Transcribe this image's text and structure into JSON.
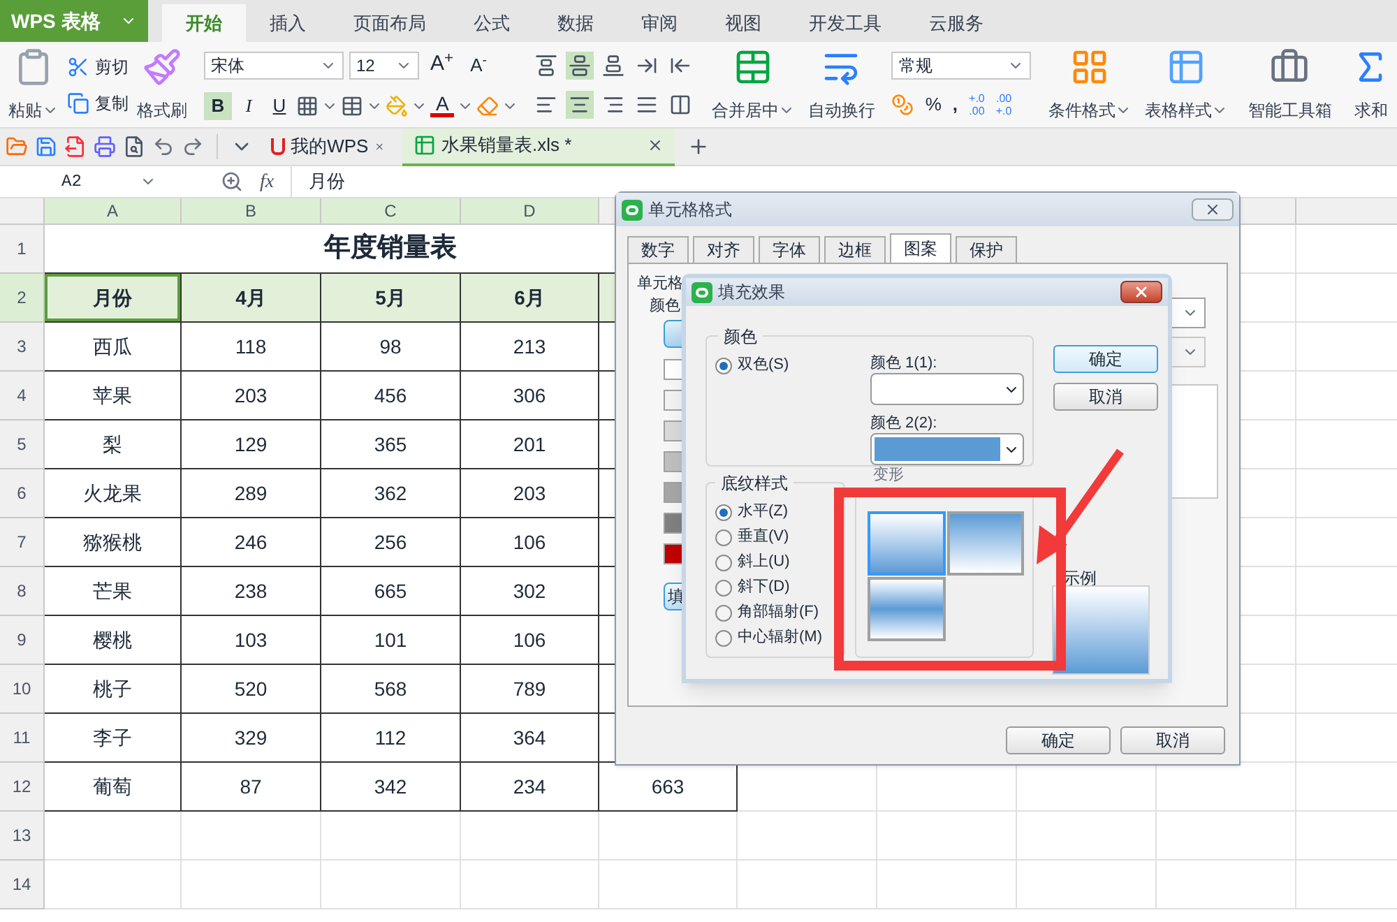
{
  "app_button": "WPS 表格",
  "menu_tabs": [
    {
      "label": "开始",
      "selected": true
    },
    {
      "label": "插入",
      "selected": false
    },
    {
      "label": "页面布局",
      "selected": false
    },
    {
      "label": "公式",
      "selected": false
    },
    {
      "label": "数据",
      "selected": false
    },
    {
      "label": "审阅",
      "selected": false
    },
    {
      "label": "视图",
      "selected": false
    },
    {
      "label": "开发工具",
      "selected": false
    },
    {
      "label": "云服务",
      "selected": false
    }
  ],
  "ribbon": {
    "paste": "粘贴",
    "cut": "剪切",
    "copy": "复制",
    "painter": "格式刷",
    "font": "宋体",
    "size": "12",
    "grow": "A$^{+}$",
    "shrink": "A$^{-}$",
    "styles": [
      {
        "label": "B",
        "kind": "bold",
        "on": true
      },
      {
        "label": "I",
        "kind": "italic",
        "on": false
      },
      {
        "label": "U",
        "kind": "underline",
        "on": false
      }
    ],
    "font_color": "A",
    "vertical_align": [
      {
        "kind": "top",
        "selected": false
      },
      {
        "kind": "middle",
        "selected": true
      },
      {
        "kind": "bottom",
        "selected": false
      }
    ],
    "horizontal_align": [
      {
        "kind": "left",
        "selected": false
      },
      {
        "kind": "center",
        "selected": true
      },
      {
        "kind": "right",
        "selected": false
      },
      {
        "kind": "justify",
        "selected": false
      }
    ],
    "merge": "合并居中",
    "wrap": "自动换行",
    "number_format": "常规",
    "percent": "%",
    "comma": ",",
    "decimals": [
      {
        "top": "+.0",
        "bottom": ".00"
      },
      {
        "top": ".00",
        "bottom": "+.0"
      }
    ],
    "conditional": "条件格式",
    "table_style": "表格样式",
    "toolbox": "智能工具箱",
    "sum": "求和"
  },
  "doc_tabs": [
    {
      "label": "我的WPS",
      "kind": "home",
      "selected": false
    },
    {
      "label": "水果销量表.xls *",
      "kind": "sheet",
      "selected": true
    }
  ],
  "formula_bar": {
    "name_box": "A2",
    "fx": "fx",
    "value": "月份"
  },
  "sheet": {
    "columns": [
      "A",
      "B",
      "C",
      "D"
    ],
    "rows": [
      {
        "number": "1",
        "kind": "title",
        "cells": [
          {
            "text": "年度销量表",
            "selected": false
          }
        ]
      },
      {
        "number": "2",
        "kind": "header",
        "cells": [
          {
            "text": "月份",
            "selected": true
          },
          {
            "text": "4月",
            "selected": false
          },
          {
            "text": "5月",
            "selected": false
          },
          {
            "text": "6月",
            "selected": false
          }
        ]
      },
      {
        "number": "3",
        "kind": "data",
        "cells": [
          {
            "text": "西瓜",
            "selected": false
          },
          {
            "text": "118",
            "selected": false
          },
          {
            "text": "98",
            "selected": false
          },
          {
            "text": "213",
            "selected": false
          }
        ]
      },
      {
        "number": "4",
        "kind": "data",
        "cells": [
          {
            "text": "苹果",
            "selected": false
          },
          {
            "text": "203",
            "selected": false
          },
          {
            "text": "456",
            "selected": false
          },
          {
            "text": "306",
            "selected": false
          }
        ]
      },
      {
        "number": "5",
        "kind": "data",
        "cells": [
          {
            "text": "梨",
            "selected": false
          },
          {
            "text": "129",
            "selected": false
          },
          {
            "text": "365",
            "selected": false
          },
          {
            "text": "201",
            "selected": false
          }
        ]
      },
      {
        "number": "6",
        "kind": "data",
        "cells": [
          {
            "text": "火龙果",
            "selected": false
          },
          {
            "text": "289",
            "selected": false
          },
          {
            "text": "362",
            "selected": false
          },
          {
            "text": "203",
            "selected": false
          }
        ]
      },
      {
        "number": "7",
        "kind": "data",
        "cells": [
          {
            "text": "猕猴桃",
            "selected": false
          },
          {
            "text": "246",
            "selected": false
          },
          {
            "text": "256",
            "selected": false
          },
          {
            "text": "106",
            "selected": false
          }
        ]
      },
      {
        "number": "8",
        "kind": "data",
        "cells": [
          {
            "text": "芒果",
            "selected": false
          },
          {
            "text": "238",
            "selected": false
          },
          {
            "text": "665",
            "selected": false
          },
          {
            "text": "302",
            "selected": false
          }
        ]
      },
      {
        "number": "9",
        "kind": "data",
        "cells": [
          {
            "text": "樱桃",
            "selected": false
          },
          {
            "text": "103",
            "selected": false
          },
          {
            "text": "101",
            "selected": false
          },
          {
            "text": "106",
            "selected": false
          }
        ]
      },
      {
        "number": "10",
        "kind": "data",
        "cells": [
          {
            "text": "桃子",
            "selected": false
          },
          {
            "text": "520",
            "selected": false
          },
          {
            "text": "568",
            "selected": false
          },
          {
            "text": "789",
            "selected": false
          }
        ]
      },
      {
        "number": "11",
        "kind": "data",
        "cells": [
          {
            "text": "李子",
            "selected": false
          },
          {
            "text": "329",
            "selected": false
          },
          {
            "text": "112",
            "selected": false
          },
          {
            "text": "364",
            "selected": false
          }
        ]
      },
      {
        "number": "12",
        "kind": "data",
        "cells": [
          {
            "text": "葡萄",
            "selected": false
          },
          {
            "text": "87",
            "selected": false
          },
          {
            "text": "342",
            "selected": false
          },
          {
            "text": "234",
            "selected": false
          },
          {
            "text": "663",
            "selected": false
          }
        ]
      },
      {
        "number": "13",
        "kind": "empty"
      },
      {
        "number": "14",
        "kind": "empty"
      }
    ]
  },
  "format_dialog": {
    "title": "单元格格式",
    "tabs": [
      {
        "label": "数字",
        "selected": false
      },
      {
        "label": "对齐",
        "selected": false
      },
      {
        "label": "字体",
        "selected": false
      },
      {
        "label": "边框",
        "selected": false
      },
      {
        "label": "图案",
        "selected": true
      },
      {
        "label": "保护",
        "selected": false
      }
    ],
    "section_label": "单元格",
    "color_label": "颜色",
    "swatches": [
      {
        "color": "#ffffff"
      },
      {
        "color": "#f2f2f2"
      },
      {
        "color": "#d9d9d9"
      },
      {
        "color": "#bfbfbf"
      },
      {
        "color": "#a6a6a6"
      },
      {
        "color": "#808080"
      },
      {
        "color": "#c00000"
      }
    ],
    "fill_button": "填",
    "ok": "确定",
    "cancel": "取消"
  },
  "fill_dialog": {
    "title": "填充效果",
    "color_group": "颜色",
    "color_modes": [
      {
        "label": "双色(S)",
        "selected": true
      }
    ],
    "color1": {
      "label": "颜色 1(1):",
      "color": "#ffffff"
    },
    "color2": {
      "label": "颜色 2(2):",
      "color": "#5b9bd5"
    },
    "ok": "确定",
    "cancel": "取消",
    "shading_group": "底纹样式",
    "shading_styles": [
      {
        "label": "水平(Z)",
        "selected": true
      },
      {
        "label": "垂直(V)",
        "selected": false
      },
      {
        "label": "斜上(U)",
        "selected": false
      },
      {
        "label": "斜下(D)",
        "selected": false
      },
      {
        "label": "角部辐射(F)",
        "selected": false
      },
      {
        "label": "中心辐射(M)",
        "selected": false
      }
    ],
    "variants_group": "变形",
    "variants": [
      {
        "kind": "down",
        "selected": true
      },
      {
        "kind": "up",
        "selected": false
      },
      {
        "kind": "middle",
        "selected": false
      }
    ],
    "sample_label": "示例"
  }
}
